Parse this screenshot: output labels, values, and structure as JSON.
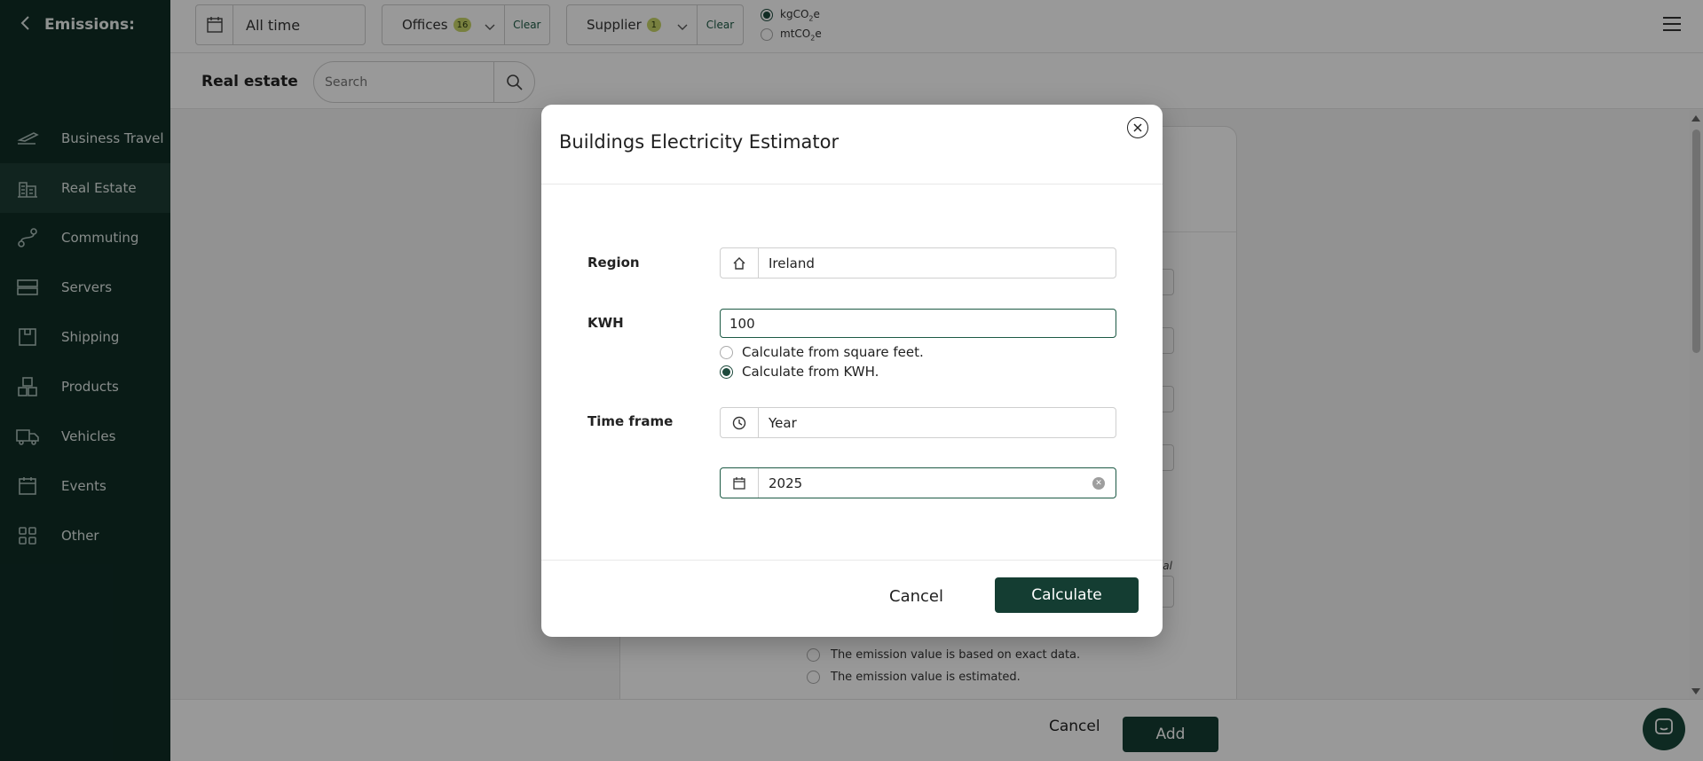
{
  "sidebar": {
    "title": "Emissions:",
    "items": [
      {
        "label": "Business Travel",
        "icon": "plane-icon"
      },
      {
        "label": "Real Estate",
        "icon": "building-icon",
        "active": true
      },
      {
        "label": "Commuting",
        "icon": "route-icon"
      },
      {
        "label": "Servers",
        "icon": "server-icon"
      },
      {
        "label": "Shipping",
        "icon": "box-icon"
      },
      {
        "label": "Products",
        "icon": "boxes-icon"
      },
      {
        "label": "Vehicles",
        "icon": "truck-icon"
      },
      {
        "label": "Events",
        "icon": "calendar-icon"
      },
      {
        "label": "Other",
        "icon": "grid-icon"
      }
    ]
  },
  "topbar": {
    "date_range": "All time",
    "offices": {
      "label": "Offices",
      "count": "16",
      "clear": "Clear"
    },
    "supplier": {
      "label": "Supplier",
      "count": "1",
      "clear": "Clear"
    },
    "units": {
      "option1": "kgCO",
      "option1_sub": "2",
      "option1_suffix": "e",
      "option2": "mtCO",
      "option2_sub": "2",
      "option2_suffix": "e",
      "selected": "kgCO2e"
    }
  },
  "subbar": {
    "title": "Real estate",
    "search_placeholder": "Search"
  },
  "background_form": {
    "note": "nal",
    "radio1": "The emission value is based on exact data.",
    "radio2": "The emission value is estimated."
  },
  "footer": {
    "cancel": "Cancel",
    "add": "Add"
  },
  "modal": {
    "title": "Buildings Electricity Estimator",
    "region_label": "Region",
    "region_value": "Ireland",
    "kwh_label": "KWH",
    "kwh_value": "100",
    "calc_option1": "Calculate from square feet.",
    "calc_option2": "Calculate from KWH.",
    "calc_selected": "kwh",
    "timeframe_label": "Time frame",
    "timeframe_value": "Year",
    "year_value": "2025",
    "cancel": "Cancel",
    "calculate": "Calculate"
  },
  "colors": {
    "sidebar_bg": "#0f2d26",
    "primary": "#143d32",
    "badge": "#c9d66a"
  }
}
